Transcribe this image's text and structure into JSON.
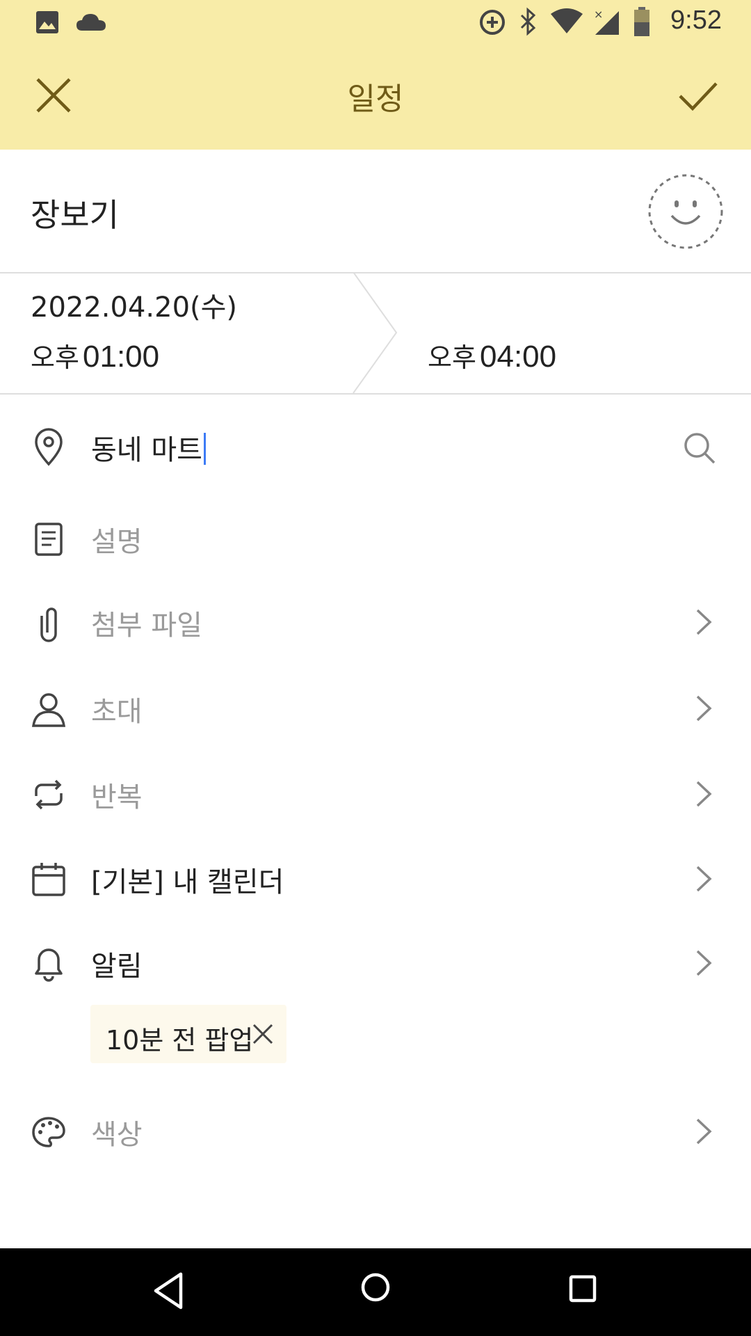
{
  "status_bar": {
    "time": "9:52"
  },
  "app_bar": {
    "title": "일정"
  },
  "event": {
    "title": "장보기",
    "date": "2022.04.20(수)",
    "start_ampm": "오후",
    "start_time": "01:00",
    "end_ampm": "오후",
    "end_time": "04:00"
  },
  "rows": {
    "location": "동네 마트",
    "description": "설명",
    "attachment": "첨부 파일",
    "invite": "초대",
    "repeat": "반복",
    "calendar": "[기본] 내 캘린더",
    "alarm": "알림",
    "alarm_chip": "10분 전 팝업",
    "color": "색상"
  },
  "colors": {
    "app_bar_bg": "#f8eca8",
    "accent": "#6f5b17",
    "cursor": "#3d7bf5"
  }
}
